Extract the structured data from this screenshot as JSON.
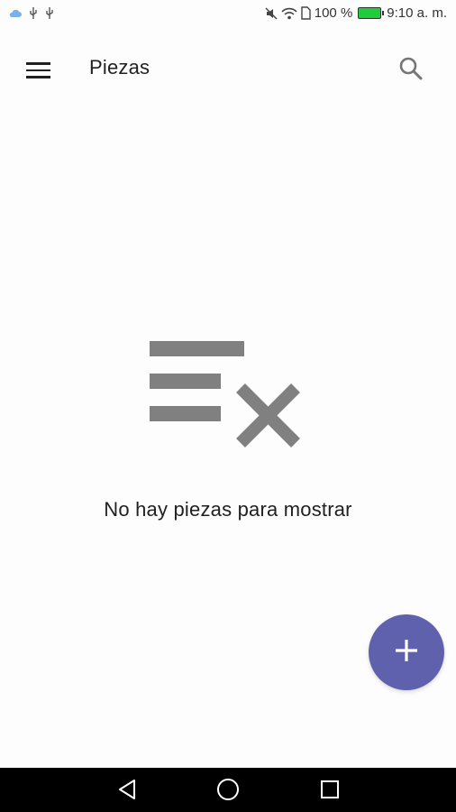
{
  "status_bar": {
    "battery_percent": "100 %",
    "time": "9:10 a. m.",
    "icons_left": [
      "cloud-icon",
      "usb-icon",
      "usb-icon"
    ],
    "icons_right": [
      "mute-icon",
      "wifi-icon",
      "sim-icon",
      "battery-icon"
    ]
  },
  "app_bar": {
    "title": "Piezas",
    "menu_icon": "menu-icon",
    "search_icon": "search-icon"
  },
  "empty_state": {
    "icon": "clear-list-icon",
    "message": "No hay piezas para mostrar"
  },
  "fab": {
    "icon": "add-icon",
    "color": "#5f61ad"
  },
  "nav_bar": {
    "buttons": [
      "back-icon",
      "home-icon",
      "recents-icon"
    ]
  }
}
